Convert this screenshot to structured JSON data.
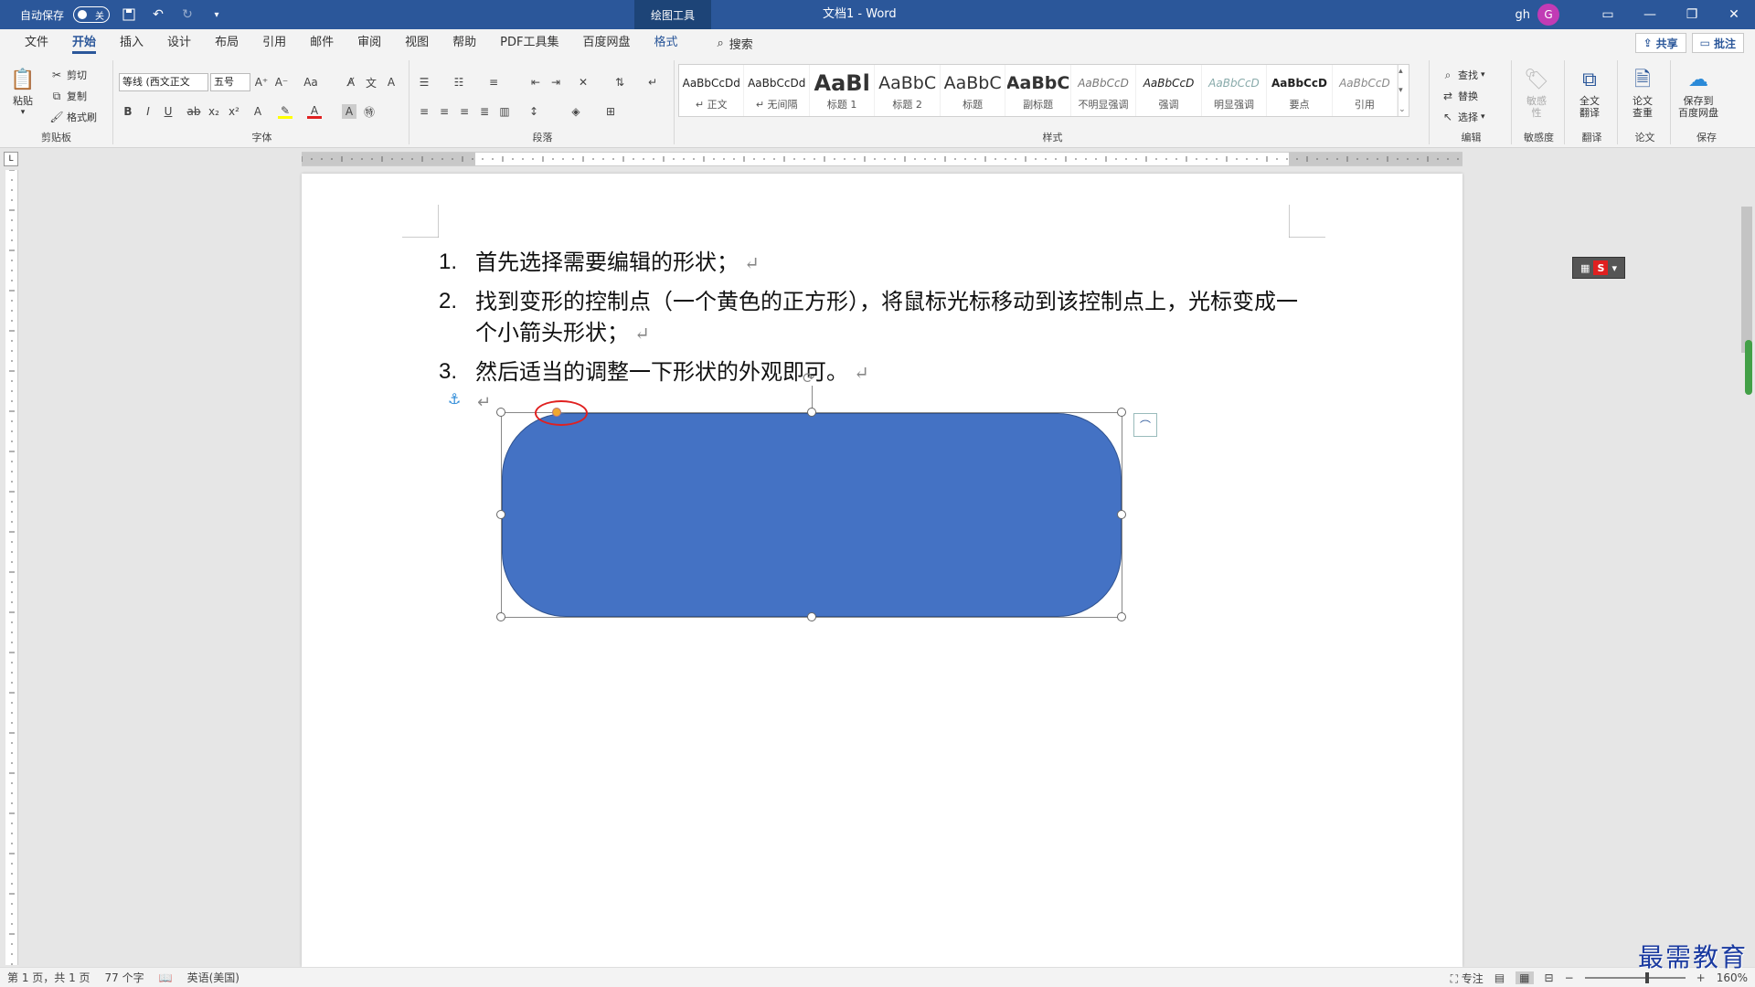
{
  "titlebar": {
    "autosave_label": "自动保存",
    "autosave_state": "关",
    "context_tab": "绘图工具",
    "doc_title": "文档1  -  Word",
    "user_name": "gh",
    "avatar_letter": "G"
  },
  "tabs": [
    "文件",
    "开始",
    "插入",
    "设计",
    "布局",
    "引用",
    "邮件",
    "审阅",
    "视图",
    "帮助",
    "PDF工具集",
    "百度网盘",
    "格式"
  ],
  "search_label": "搜索",
  "share_label": "共享",
  "comment_label": "批注",
  "clipboard": {
    "paste": "粘贴",
    "cut": "剪切",
    "copy": "复制",
    "format_painter": "格式刷",
    "label": "剪贴板"
  },
  "font": {
    "name": "等线 (西文正文",
    "size": "五号",
    "label": "字体"
  },
  "paragraph_label": "段落",
  "styles": {
    "label": "样式",
    "items": [
      {
        "preview": "AaBbCcDd",
        "name": "↵ 正文"
      },
      {
        "preview": "AaBbCcDd",
        "name": "↵ 无间隔"
      },
      {
        "preview": "AaBl",
        "name": "标题 1"
      },
      {
        "preview": "AaBbC",
        "name": "标题 2"
      },
      {
        "preview": "AaBbC",
        "name": "标题"
      },
      {
        "preview": "AaBbC",
        "name": "副标题"
      },
      {
        "preview": "AaBbCcD",
        "name": "不明显强调"
      },
      {
        "preview": "AaBbCcD",
        "name": "强调"
      },
      {
        "preview": "AaBbCcD",
        "name": "明显强调"
      },
      {
        "preview": "AaBbCcD",
        "name": "要点"
      },
      {
        "preview": "AaBbCcD",
        "name": "引用"
      }
    ]
  },
  "editing": {
    "find": "查找",
    "replace": "替换",
    "select": "选择",
    "label": "编辑"
  },
  "sensitivity": {
    "btn": "敏感\n性",
    "label": "敏感度"
  },
  "translate": {
    "btn": "全文\n翻译",
    "label": "翻译"
  },
  "paper": {
    "btn": "论文\n查重",
    "label": "论文"
  },
  "save_group": {
    "btn": "保存到\n百度网盘",
    "label": "保存"
  },
  "document": {
    "items": [
      {
        "num": "1.",
        "text": "首先选择需要编辑的形状；"
      },
      {
        "num": "2.",
        "text": "找到变形的控制点（一个黄色的正方形），将鼠标光标移动到该控制点上，光标变成一个小箭头形状；"
      },
      {
        "num": "3.",
        "text": "然后适当的调整一下形状的外观即可。"
      }
    ],
    "return_mark": "↵",
    "anchor_icon": "⚓"
  },
  "shape": {
    "fill": "#4472c4"
  },
  "status": {
    "page": "第 1 页，共 1 页",
    "words": "77 个字",
    "language": "英语(美国)",
    "focus": "专注",
    "zoom": "160%"
  },
  "watermark": "最需教育"
}
